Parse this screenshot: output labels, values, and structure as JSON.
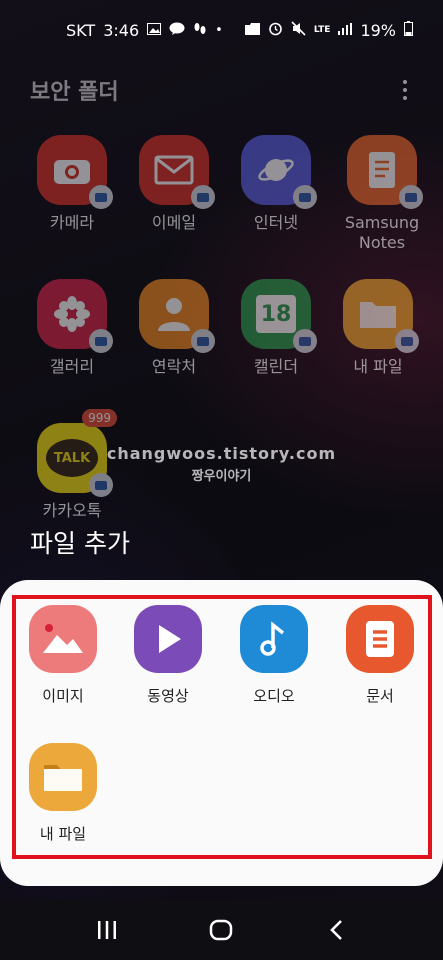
{
  "status_bar": {
    "carrier": "SKT",
    "time": "3:46",
    "network": "LTE",
    "battery": "19%"
  },
  "folder": {
    "title": "보안 폴더"
  },
  "apps": [
    {
      "label": "카메라",
      "color": "#d9342b",
      "icon": "camera-icon"
    },
    {
      "label": "이메일",
      "color": "#d9342b",
      "icon": "email-icon"
    },
    {
      "label": "인터넷",
      "color": "#5b5fe0",
      "icon": "internet-icon"
    },
    {
      "label": "Samsung\nNotes",
      "color": "#ef6a2e",
      "icon": "notes-icon"
    },
    {
      "label": "갤러리",
      "color": "#d4254a",
      "icon": "gallery-icon"
    },
    {
      "label": "연락처",
      "color": "#f08a24",
      "icon": "contacts-icon"
    },
    {
      "label": "캘린더",
      "color": "#2a9d4e",
      "icon": "calendar-icon",
      "day": "18"
    },
    {
      "label": "내 파일",
      "color": "#f0a92d",
      "icon": "folder-icon"
    },
    {
      "label": "카카오톡",
      "color": "#f7e317",
      "icon": "kakaotalk-icon",
      "text": "TALK",
      "badge": "999"
    }
  ],
  "watermark": {
    "line1": "changwoos.tistory.com",
    "line2": "짱우이야기"
  },
  "sheet": {
    "title": "파일 추가",
    "options": [
      {
        "label": "이미지",
        "color": "#ee7b7b",
        "icon": "image-icon"
      },
      {
        "label": "동영상",
        "color": "#7b4bb8",
        "icon": "video-icon"
      },
      {
        "label": "오디오",
        "color": "#1f8ad6",
        "icon": "audio-icon"
      },
      {
        "label": "문서",
        "color": "#e8582e",
        "icon": "document-icon"
      },
      {
        "label": "내 파일",
        "color": "#eca83a",
        "icon": "my-files-icon"
      }
    ]
  }
}
